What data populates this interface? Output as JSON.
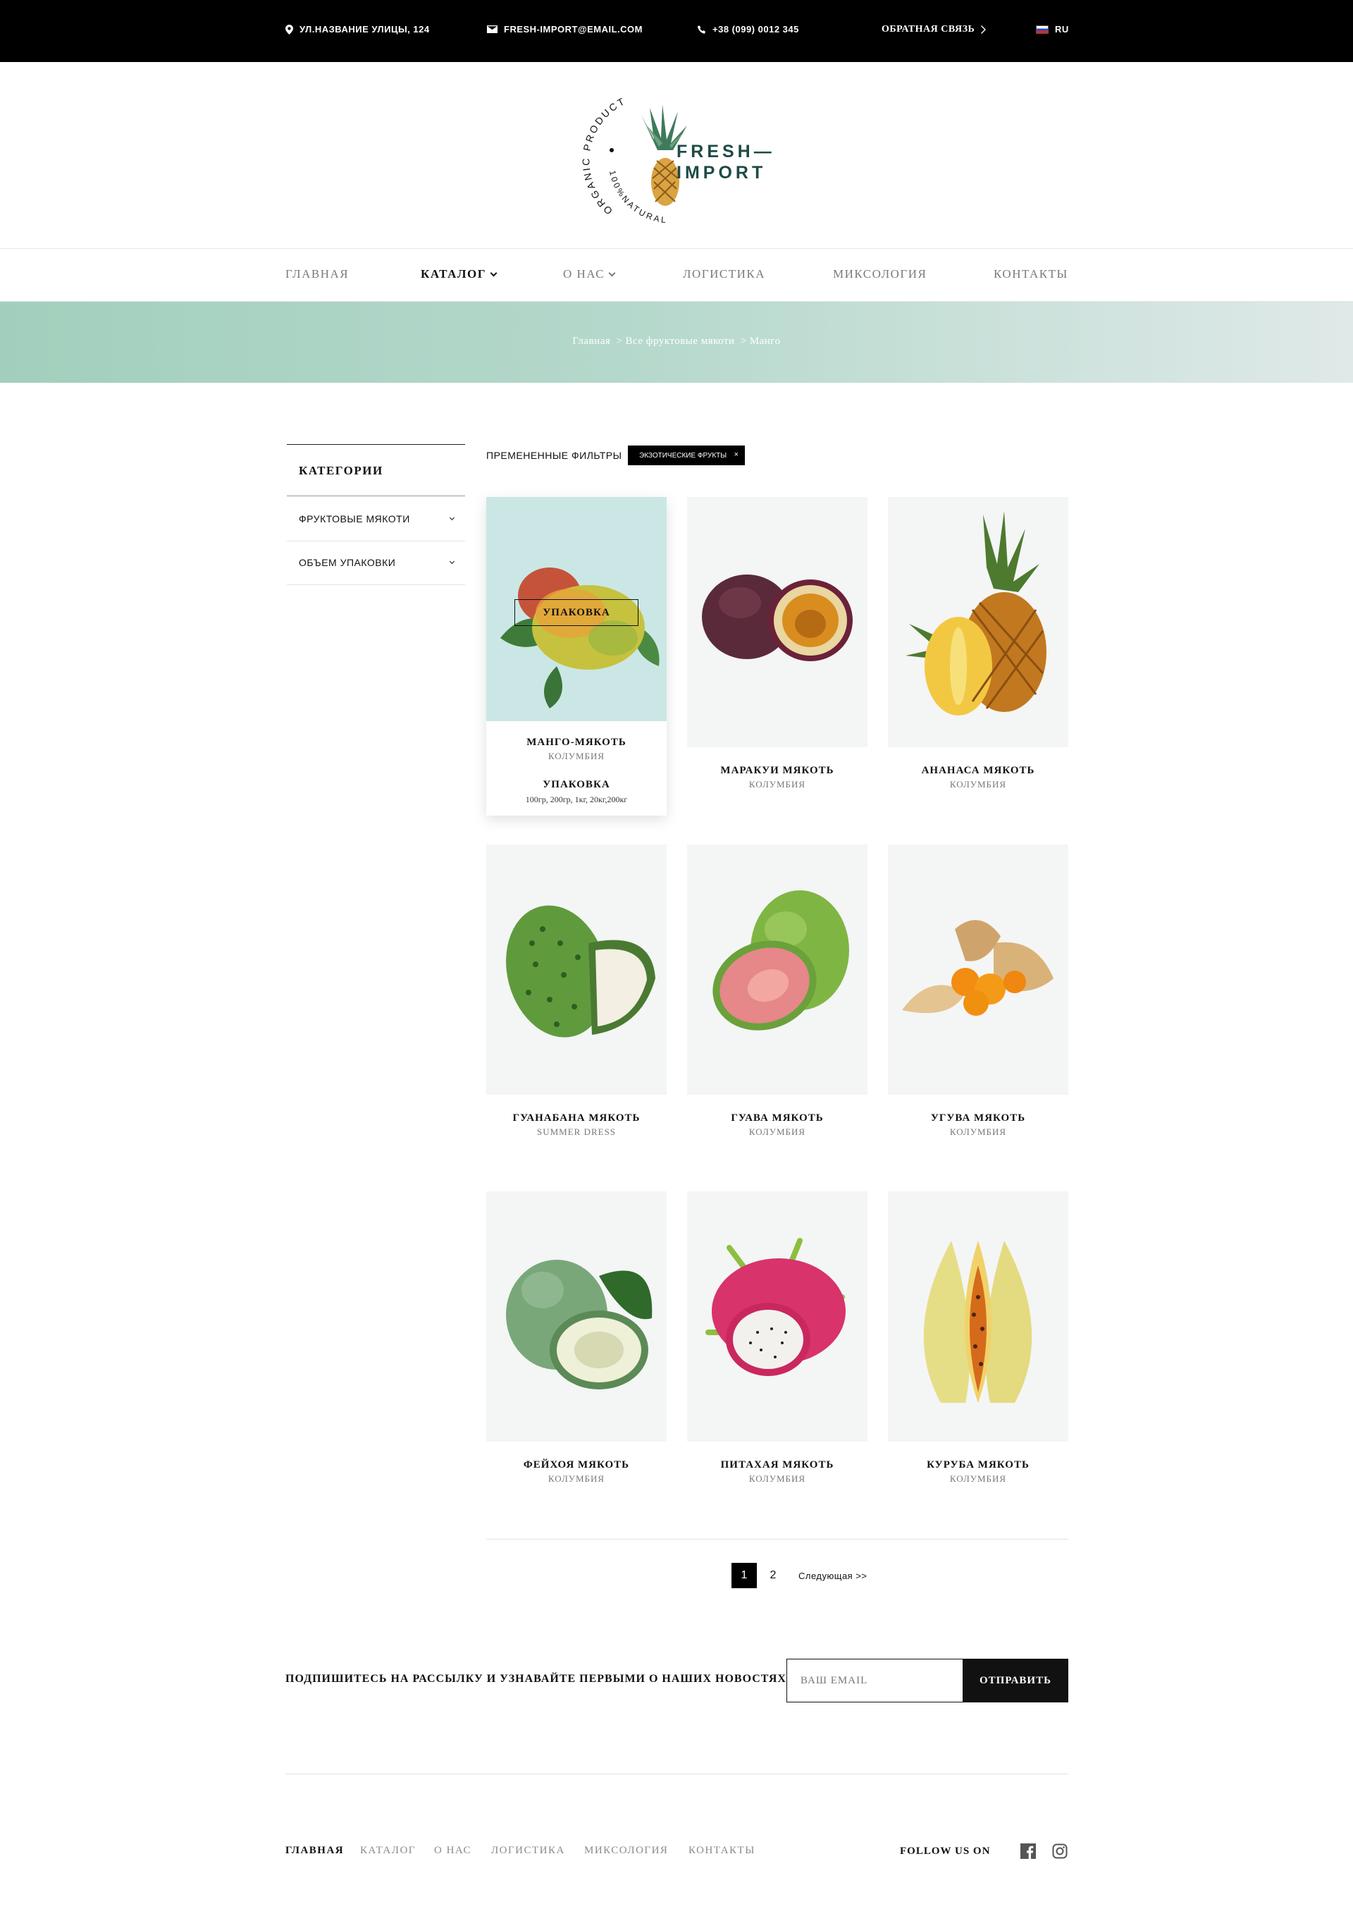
{
  "topbar": {
    "address": "УЛ.НАЗВАНИЕ УЛИЦЫ, 124",
    "email": "FRESH-IMPORT@EMAIL.COM",
    "phone": "+38 (099) 0012 345",
    "feedback": "ОБРАТНАЯ СВЯЗЬ",
    "language": "RU"
  },
  "logo": {
    "line1": "FRESH—",
    "line2": "IMPORT",
    "ring_top": "ORGANIC PRODUCT",
    "ring_bottom": "100%NATURAL"
  },
  "nav": {
    "items": [
      {
        "label": "ГЛАВНАЯ"
      },
      {
        "label": "КАТАЛОГ"
      },
      {
        "label": "О НАС"
      },
      {
        "label": "ЛОГИСТИКА"
      },
      {
        "label": "МИКСОЛОГИЯ"
      },
      {
        "label": "КОНТАКТЫ"
      }
    ]
  },
  "breadcrumb": {
    "home": "Главная",
    "section": "Все фруктовые мякоти",
    "current": "Манго",
    "separator": ">"
  },
  "sidebar": {
    "title": "КАТЕГОРИИ",
    "items": [
      {
        "label": "ФРУКТОВЫЕ МЯКОТИ"
      },
      {
        "label": "ОБЪЕМ УПАКОВКИ"
      }
    ]
  },
  "filters": {
    "label": "ПРЕМЕНЕННЫЕ ФИЛЬТРЫ",
    "active": "ЭКЗОТИЧЕСКИЕ ФРУКТЫ",
    "remove": "×"
  },
  "products": [
    {
      "name": "МАНГО-МЯКОТЬ",
      "origin": "КОЛУМБИЯ",
      "button": "УПАКОВКА",
      "pack_title": "УПАКОВКА",
      "pack_sizes": "100гр, 200гр, 1кг, 20кг,200кг",
      "icon": "mango-image"
    },
    {
      "name": "МАРАКУИ МЯКОТЬ",
      "origin": "КОЛУМБИЯ",
      "icon": "passion-fruit-image"
    },
    {
      "name": "АНАНАСА МЯКОТЬ",
      "origin": "КОЛУМБИЯ",
      "icon": "pineapple-image"
    },
    {
      "name": "ГУАНАБАНА МЯКОТЬ",
      "origin": "SUMMER DRESS",
      "icon": "soursop-image"
    },
    {
      "name": "ГУАВА МЯКОТЬ",
      "origin": "КОЛУМБИЯ",
      "icon": "guava-image"
    },
    {
      "name": "УГУВА МЯКОТЬ",
      "origin": "КОЛУМБИЯ",
      "icon": "physalis-image"
    },
    {
      "name": "ФЕЙХОЯ МЯКОТЬ",
      "origin": "КОЛУМБИЯ",
      "icon": "feijoa-image"
    },
    {
      "name": "ПИТАХАЯ МЯКОТЬ",
      "origin": "КОЛУМБИЯ",
      "icon": "dragon-fruit-image"
    },
    {
      "name": "КУРУБА МЯКОТЬ",
      "origin": "КОЛУМБИЯ",
      "icon": "curuba-image"
    }
  ],
  "pagination": {
    "pages": [
      "1",
      "2"
    ],
    "current": "1",
    "next": "Следующая >>"
  },
  "newsletter": {
    "text": "ПОДПИШИТЕСЬ НА РАССЫЛКУ И УЗНАВАЙТЕ ПЕРВЫМИ О НАШИХ НОВОСТЯХ",
    "placeholder": "ВАШ EMAIL",
    "button": "ОТПРАВИТЬ"
  },
  "footer": {
    "links": [
      {
        "label": "ГЛАВНАЯ"
      },
      {
        "label": "КАТАЛОГ"
      },
      {
        "label": "О НАС"
      },
      {
        "label": "ЛОГИСТИКА"
      },
      {
        "label": "МИКСОЛОГИЯ"
      },
      {
        "label": "КОНТАКТЫ"
      }
    ],
    "follow": "FOLLOW US ON",
    "social": [
      "facebook-icon",
      "instagram-icon"
    ]
  },
  "colors": {
    "brand_dark_green": "#1d4b45",
    "banner_start": "#a2cfbd",
    "banner_end": "#dfe9e8",
    "accent_black": "#000000"
  }
}
